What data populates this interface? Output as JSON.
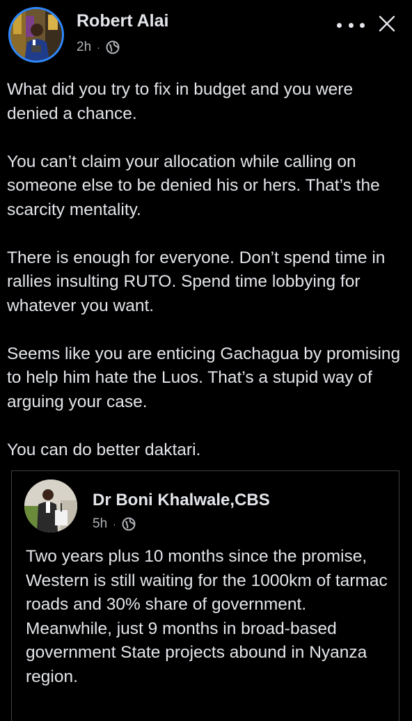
{
  "colors": {
    "background": "#000000",
    "text_primary": "#e4e6eb",
    "text_secondary": "#b0b3b8",
    "avatar_ring": "#2d88ff",
    "card_border": "#3e4042"
  },
  "post": {
    "author": "Robert Alai",
    "time": "2h",
    "separator": "·",
    "audience_icon": "globe-icon",
    "more_icon": "more-options-icon",
    "close_icon": "close-icon",
    "paragraphs": [
      "What did you try to fix in budget and you were denied a chance.",
      "You can’t claim your allocation while calling on someone else to be denied his or hers. That’s the scarcity mentality.",
      "There is enough for everyone. Don’t spend time in rallies insulting RUTO. Spend time lobbying for whatever you want.",
      "Seems like you are enticing Gachagua by promising to help him hate the Luos. That’s a stupid way of arguing your case.",
      "You can do better daktari."
    ]
  },
  "shared_post": {
    "author": "Dr Boni Khalwale,CBS",
    "time": "5h",
    "separator": "·",
    "audience_icon": "globe-icon",
    "paragraphs": [
      "Two years plus 10 months since the promise, Western is still waiting for the 1000km of tarmac roads and 30% share of government.",
      "Meanwhile, just 9 months in broad-based government State projects abound in Nyanza region."
    ]
  }
}
